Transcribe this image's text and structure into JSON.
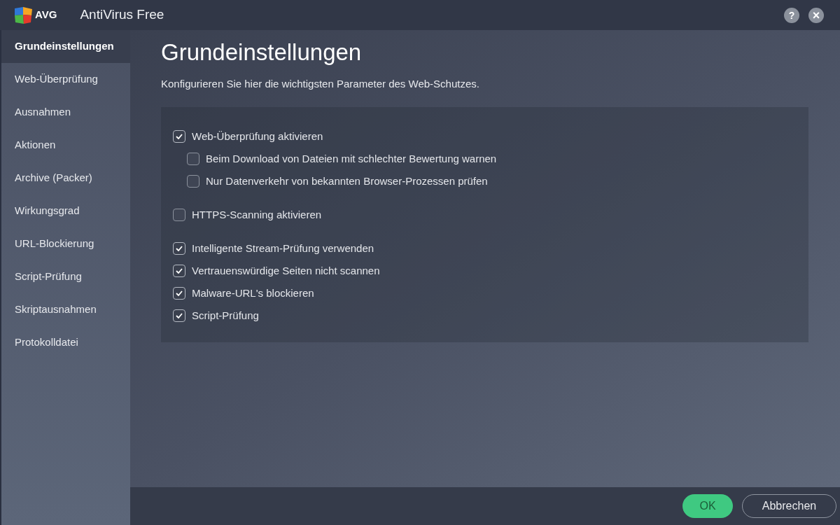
{
  "window": {
    "logo_text": "AVG",
    "title": "AntiVirus Free",
    "help_button": "?",
    "close_button": "×"
  },
  "sidebar": {
    "items": [
      {
        "label": "Grundeinstellungen",
        "selected": true
      },
      {
        "label": "Web-Überprüfung",
        "selected": false
      },
      {
        "label": "Ausnahmen",
        "selected": false
      },
      {
        "label": "Aktionen",
        "selected": false
      },
      {
        "label": "Archive (Packer)",
        "selected": false
      },
      {
        "label": "Wirkungsgrad",
        "selected": false
      },
      {
        "label": "URL-Blockierung",
        "selected": false
      },
      {
        "label": "Script-Prüfung",
        "selected": false
      },
      {
        "label": "Skriptausnahmen",
        "selected": false
      },
      {
        "label": "Protokolldatei",
        "selected": false
      }
    ]
  },
  "page": {
    "title": "Grundeinstellungen",
    "description": "Konfigurieren Sie hier die wichtigsten Parameter des Web-Schutzes.",
    "option_groups": [
      {
        "options": [
          {
            "label": "Web-Überprüfung aktivieren",
            "checked": true,
            "children": [
              {
                "label": "Beim Download von Dateien mit schlechter Bewertung warnen",
                "checked": false
              },
              {
                "label": "Nur Datenverkehr von bekannten Browser-Prozessen prüfen",
                "checked": false
              }
            ]
          }
        ]
      },
      {
        "options": [
          {
            "label": "HTTPS-Scanning aktivieren",
            "checked": false
          }
        ]
      },
      {
        "options": [
          {
            "label": "Intelligente Stream-Prüfung verwenden",
            "checked": true
          },
          {
            "label": "Vertrauenswürdige Seiten nicht scannen",
            "checked": true
          },
          {
            "label": "Malware-URL's blockieren",
            "checked": true
          },
          {
            "label": "Script-Prüfung",
            "checked": true
          }
        ]
      }
    ]
  },
  "footer": {
    "buttons": [
      {
        "label": "OK",
        "kind": "primary"
      },
      {
        "label": "Abbrechen",
        "kind": "secondary"
      }
    ]
  }
}
